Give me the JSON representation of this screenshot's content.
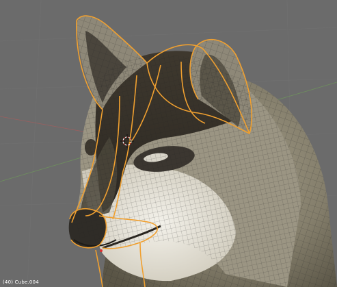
{
  "viewport": {
    "status_frame": "(40)",
    "status_object": "Cube.004"
  },
  "colors": {
    "background": "#6b6b6b",
    "grid": "#767676",
    "x_axis": "#9a6060",
    "y_axis": "#6f9a5a",
    "selected_edge": "#f0a030",
    "wire": "#2a2a2a",
    "fur_light": "#e9e6dc",
    "fur_dark": "#3a352d",
    "fur_mid": "#8d8674"
  },
  "icons": [
    "3d-cursor-icon"
  ]
}
